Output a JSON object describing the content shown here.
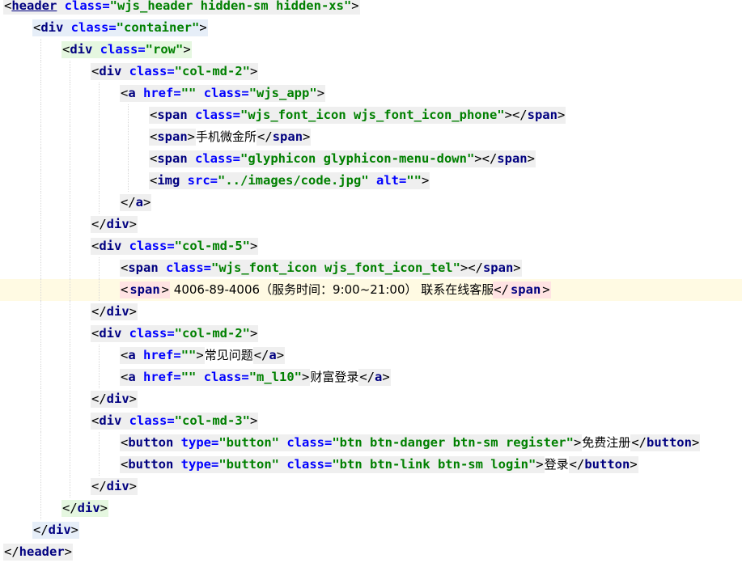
{
  "lines": [
    {
      "indent": 0,
      "tokens": [
        {
          "c": "p",
          "t": "<"
        },
        {
          "c": "t",
          "t": "header",
          "u": 1
        },
        {
          "c": "a",
          "t": " class="
        },
        {
          "c": "v",
          "t": "\"wjs_header hidden-sm hidden-xs\""
        },
        {
          "c": "p",
          "t": ">"
        }
      ]
    },
    {
      "indent": 1,
      "bg": "blu",
      "tokens": [
        {
          "c": "p",
          "t": "<"
        },
        {
          "c": "t",
          "t": "div"
        },
        {
          "c": "a",
          "t": " class="
        },
        {
          "c": "v",
          "t": "\"container\""
        },
        {
          "c": "p",
          "t": ">"
        }
      ]
    },
    {
      "indent": 2,
      "bg": "grn",
      "tokens": [
        {
          "c": "p",
          "t": "<"
        },
        {
          "c": "t",
          "t": "div"
        },
        {
          "c": "a",
          "t": " class="
        },
        {
          "c": "v",
          "t": "\"row\""
        },
        {
          "c": "p",
          "t": ">"
        }
      ]
    },
    {
      "indent": 3,
      "tokens": [
        {
          "c": "p",
          "t": "<"
        },
        {
          "c": "t",
          "t": "div"
        },
        {
          "c": "a",
          "t": " class="
        },
        {
          "c": "v",
          "t": "\"col-md-2\""
        },
        {
          "c": "p",
          "t": ">"
        }
      ]
    },
    {
      "indent": 4,
      "tokens": [
        {
          "c": "p",
          "t": "<"
        },
        {
          "c": "t",
          "t": "a"
        },
        {
          "c": "a",
          "t": " href="
        },
        {
          "c": "v",
          "t": "\"\""
        },
        {
          "c": "a",
          "t": " class="
        },
        {
          "c": "v",
          "t": "\"wjs_app\""
        },
        {
          "c": "p",
          "t": ">"
        }
      ]
    },
    {
      "indent": 5,
      "tokens": [
        {
          "c": "p",
          "t": "<"
        },
        {
          "c": "t",
          "t": "span"
        },
        {
          "c": "a",
          "t": " class="
        },
        {
          "c": "v",
          "t": "\"wjs_font_icon wjs_font_icon_phone\""
        },
        {
          "c": "p",
          "t": "></"
        },
        {
          "c": "t",
          "t": "span"
        },
        {
          "c": "p",
          "t": ">"
        }
      ]
    },
    {
      "indent": 5,
      "tokens": [
        {
          "c": "p",
          "t": "<"
        },
        {
          "c": "t",
          "t": "span"
        },
        {
          "c": "p",
          "t": ">"
        },
        {
          "c": "txt",
          "t": "手机微金所"
        },
        {
          "c": "p",
          "t": "</"
        },
        {
          "c": "t",
          "t": "span"
        },
        {
          "c": "p",
          "t": ">"
        }
      ]
    },
    {
      "indent": 5,
      "tokens": [
        {
          "c": "p",
          "t": "<"
        },
        {
          "c": "t",
          "t": "span"
        },
        {
          "c": "a",
          "t": " class="
        },
        {
          "c": "v",
          "t": "\"glyphicon glyphicon-menu-down\""
        },
        {
          "c": "p",
          "t": "></"
        },
        {
          "c": "t",
          "t": "span"
        },
        {
          "c": "p",
          "t": ">"
        }
      ]
    },
    {
      "indent": 5,
      "tokens": [
        {
          "c": "p",
          "t": "<"
        },
        {
          "c": "t",
          "t": "img"
        },
        {
          "c": "a",
          "t": " src="
        },
        {
          "c": "v",
          "t": "\"../images/code.jpg\""
        },
        {
          "c": "a",
          "t": " alt="
        },
        {
          "c": "v",
          "t": "\"\""
        },
        {
          "c": "p",
          "t": ">"
        }
      ]
    },
    {
      "indent": 4,
      "tokens": [
        {
          "c": "p",
          "t": "</"
        },
        {
          "c": "t",
          "t": "a"
        },
        {
          "c": "p",
          "t": ">"
        }
      ]
    },
    {
      "indent": 3,
      "tokens": [
        {
          "c": "p",
          "t": "</"
        },
        {
          "c": "t",
          "t": "div"
        },
        {
          "c": "p",
          "t": ">"
        }
      ]
    },
    {
      "indent": 3,
      "tokens": [
        {
          "c": "p",
          "t": "<"
        },
        {
          "c": "t",
          "t": "div"
        },
        {
          "c": "a",
          "t": " class="
        },
        {
          "c": "v",
          "t": "\"col-md-5\""
        },
        {
          "c": "p",
          "t": ">"
        }
      ]
    },
    {
      "indent": 4,
      "tokens": [
        {
          "c": "p",
          "t": "<"
        },
        {
          "c": "t",
          "t": "span"
        },
        {
          "c": "a",
          "t": " class="
        },
        {
          "c": "v",
          "t": "\"wjs_font_icon wjs_font_icon_tel\""
        },
        {
          "c": "p",
          "t": "></"
        },
        {
          "c": "t",
          "t": "span"
        },
        {
          "c": "p",
          "t": ">"
        }
      ]
    },
    {
      "indent": 4,
      "current": true,
      "plain": true,
      "tokens": [
        {
          "c": "p",
          "t": "<",
          "bg": "pink"
        },
        {
          "c": "t",
          "t": "span",
          "bg": "pink"
        },
        {
          "c": "p",
          "t": ">",
          "bg": "pink"
        },
        {
          "c": "txt",
          "t": " 4006-89-4006（服务时间：9:00~21:00） 联系在线客服"
        },
        {
          "caret": true
        },
        {
          "c": "p",
          "t": "</",
          "bg": "pink"
        },
        {
          "c": "t",
          "t": "span",
          "bg": "pink"
        },
        {
          "c": "p",
          "t": ">",
          "bg": "pink"
        }
      ]
    },
    {
      "indent": 3,
      "tokens": [
        {
          "c": "p",
          "t": "</"
        },
        {
          "c": "t",
          "t": "div"
        },
        {
          "c": "p",
          "t": ">"
        }
      ]
    },
    {
      "indent": 3,
      "tokens": [
        {
          "c": "p",
          "t": "<"
        },
        {
          "c": "t",
          "t": "div"
        },
        {
          "c": "a",
          "t": " class="
        },
        {
          "c": "v",
          "t": "\"col-md-2\""
        },
        {
          "c": "p",
          "t": ">"
        }
      ]
    },
    {
      "indent": 4,
      "tokens": [
        {
          "c": "p",
          "t": "<"
        },
        {
          "c": "t",
          "t": "a"
        },
        {
          "c": "a",
          "t": " href="
        },
        {
          "c": "v",
          "t": "\"\""
        },
        {
          "c": "p",
          "t": ">"
        },
        {
          "c": "txt",
          "t": "常见问题"
        },
        {
          "c": "p",
          "t": "</"
        },
        {
          "c": "t",
          "t": "a"
        },
        {
          "c": "p",
          "t": ">"
        }
      ]
    },
    {
      "indent": 4,
      "tokens": [
        {
          "c": "p",
          "t": "<"
        },
        {
          "c": "t",
          "t": "a"
        },
        {
          "c": "a",
          "t": " href="
        },
        {
          "c": "v",
          "t": "\"\""
        },
        {
          "c": "a",
          "t": " class="
        },
        {
          "c": "v",
          "t": "\"m_l10\""
        },
        {
          "c": "p",
          "t": ">"
        },
        {
          "c": "txt",
          "t": "财富登录"
        },
        {
          "c": "p",
          "t": "</"
        },
        {
          "c": "t",
          "t": "a"
        },
        {
          "c": "p",
          "t": ">"
        }
      ]
    },
    {
      "indent": 3,
      "tokens": [
        {
          "c": "p",
          "t": "</"
        },
        {
          "c": "t",
          "t": "div"
        },
        {
          "c": "p",
          "t": ">"
        }
      ]
    },
    {
      "indent": 3,
      "tokens": [
        {
          "c": "p",
          "t": "<"
        },
        {
          "c": "t",
          "t": "div"
        },
        {
          "c": "a",
          "t": " class="
        },
        {
          "c": "v",
          "t": "\"col-md-3\""
        },
        {
          "c": "p",
          "t": ">"
        }
      ]
    },
    {
      "indent": 4,
      "tokens": [
        {
          "c": "p",
          "t": "<"
        },
        {
          "c": "t",
          "t": "button"
        },
        {
          "c": "a",
          "t": " type="
        },
        {
          "c": "v",
          "t": "\"button\""
        },
        {
          "c": "a",
          "t": " class="
        },
        {
          "c": "v",
          "t": "\"btn btn-danger btn-sm register\""
        },
        {
          "c": "p",
          "t": ">"
        },
        {
          "c": "txt",
          "t": "免费注册"
        },
        {
          "c": "p",
          "t": "</"
        },
        {
          "c": "t",
          "t": "button"
        },
        {
          "c": "p",
          "t": ">"
        }
      ]
    },
    {
      "indent": 4,
      "tokens": [
        {
          "c": "p",
          "t": "<"
        },
        {
          "c": "t",
          "t": "button"
        },
        {
          "c": "a",
          "t": " type="
        },
        {
          "c": "v",
          "t": "\"button\""
        },
        {
          "c": "a",
          "t": " class="
        },
        {
          "c": "v",
          "t": "\"btn btn-link btn-sm login\""
        },
        {
          "c": "p",
          "t": ">"
        },
        {
          "c": "txt",
          "t": "登录"
        },
        {
          "c": "p",
          "t": "</"
        },
        {
          "c": "t",
          "t": "button"
        },
        {
          "c": "p",
          "t": ">"
        }
      ]
    },
    {
      "indent": 3,
      "tokens": [
        {
          "c": "p",
          "t": "</"
        },
        {
          "c": "t",
          "t": "div"
        },
        {
          "c": "p",
          "t": ">"
        }
      ]
    },
    {
      "indent": 2,
      "bg": "grn",
      "tokens": [
        {
          "c": "p",
          "t": "</"
        },
        {
          "c": "t",
          "t": "div"
        },
        {
          "c": "p",
          "t": ">"
        }
      ]
    },
    {
      "indent": 1,
      "bg": "blu",
      "tokens": [
        {
          "c": "p",
          "t": "</"
        },
        {
          "c": "t",
          "t": "div"
        },
        {
          "c": "p",
          "t": ">"
        }
      ]
    },
    {
      "indent": 0,
      "tokens": [
        {
          "c": "p",
          "t": "</"
        },
        {
          "c": "t",
          "t": "header"
        },
        {
          "c": "p",
          "t": ">"
        }
      ]
    }
  ]
}
